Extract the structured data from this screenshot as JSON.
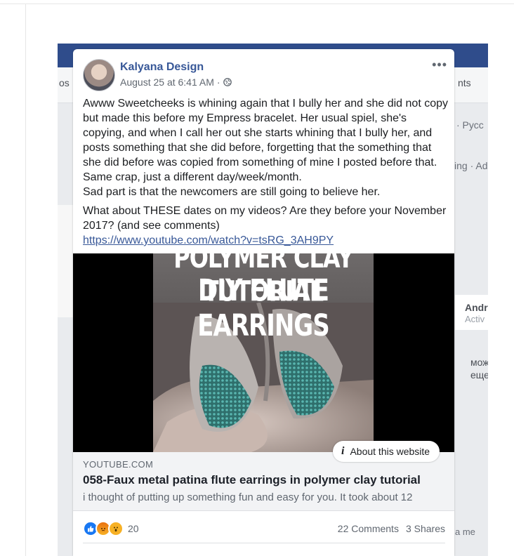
{
  "post": {
    "author": "Kalyana Design",
    "timestamp": "August 25 at 6:41 AM",
    "separator": "·",
    "more_label": "•••",
    "paragraphs": [
      "Awww Sweetcheeks is whining again that I bully her and she did not copy but made this before my Empress bracelet. Her usual spiel, she's copying, and when I call her out she starts whining that I bully her, and posts something that she did before, forgetting that the something that she did before was copied from something of mine I posted before that. Same crap, just a different day/week/month.\nSad part is that the newcomers are still going to believe her.",
      "What about THESE dates on my videos? Are they before your November 2017? (and see comments)"
    ],
    "link": "https://www.youtube.com/watch?v=tsRG_3AH9PY"
  },
  "preview": {
    "thumb_line1": "POLYMER CLAY TUTORIAL",
    "thumb_line2": "DIY FLUTE EARRINGS",
    "about_label": "About this website",
    "domain": "YOUTUBE.COM",
    "title": "058-Faux metal patina flute earrings in polymer clay tutorial",
    "description": "i thought of putting up something fun and easy for you. It took about 12"
  },
  "stats": {
    "reaction_count": "20",
    "comments": "22 Comments",
    "shares": "3 Shares"
  },
  "background": {
    "tab_partial": "nts",
    "side_partial": "os",
    "lang_partial": "· Русс",
    "activity_partial": "ing · Ad",
    "name_partial": "Andr",
    "status_partial": "Activ",
    "snippet1": "мож",
    "snippet2": "еще",
    "chat_partial": "a me"
  },
  "colors": {
    "link": "#385898",
    "like": "#1877f2",
    "bg_header": "#2f4c8b"
  }
}
